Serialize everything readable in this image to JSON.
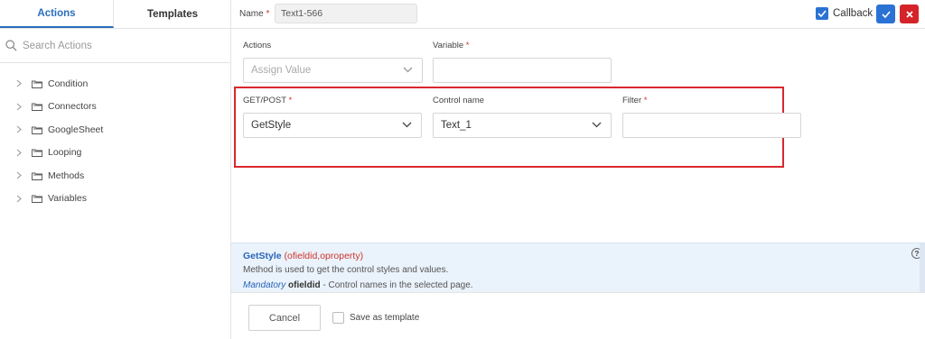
{
  "sidebar": {
    "tabs": [
      {
        "label": "Actions"
      },
      {
        "label": "Templates"
      }
    ],
    "search": {
      "placeholder": "Search Actions"
    },
    "items": [
      {
        "label": "Condition"
      },
      {
        "label": "Connectors"
      },
      {
        "label": "GoogleSheet"
      },
      {
        "label": "Looping"
      },
      {
        "label": "Methods"
      },
      {
        "label": "Variables"
      }
    ]
  },
  "header": {
    "name_label": "Name",
    "name_required": "*",
    "name_value": "Text1-566",
    "callback_label": "Callback",
    "callback_checked": true
  },
  "form": {
    "actions_label": "Actions",
    "actions_value": "Assign Value",
    "variable_label": "Variable",
    "variable_required": "*",
    "variable_value": "",
    "method_label": "GET/POST",
    "method_required": "*",
    "method_value": "GetStyle",
    "control_label": "Control name",
    "control_value": "Text_1",
    "filter_label": "Filter",
    "filter_required": "*",
    "filter_value": ""
  },
  "help": {
    "function_name": "GetStyle",
    "params": "(ofieldid,oproperty)",
    "description": "Method is used to get the control styles and values.",
    "mandatory_label": "Mandatory",
    "mandatory_param": "ofieldid",
    "mandatory_desc": "- Control names in the selected page.",
    "icon_glyph": "?"
  },
  "footer": {
    "cancel_label": "Cancel",
    "save_template_label": "Save as template"
  },
  "colors": {
    "accent": "#2a72d4",
    "danger": "#d4242a",
    "highlight_border": "#d9272e",
    "help_bg": "#eaf2fb"
  }
}
